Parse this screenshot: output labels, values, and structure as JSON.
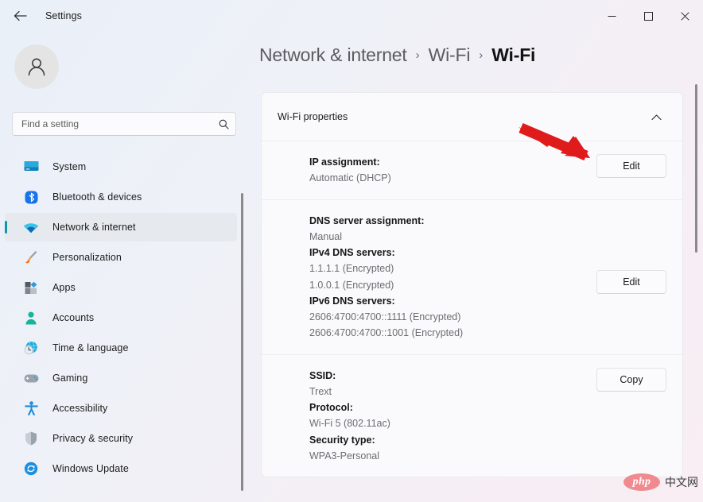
{
  "titlebar": {
    "back_icon": "back-arrow-icon",
    "app_title": "Settings",
    "minimize_label": "—",
    "maximize_label": "☐",
    "close_label": "✕"
  },
  "sidebar": {
    "avatar_icon": "user-avatar-icon",
    "search": {
      "placeholder": "Find a setting",
      "value": "",
      "icon": "search-icon"
    },
    "items": [
      {
        "label": "System",
        "icon": "monitor-icon",
        "active": false
      },
      {
        "label": "Bluetooth & devices",
        "icon": "bluetooth-icon",
        "active": false
      },
      {
        "label": "Network & internet",
        "icon": "wifi-icon",
        "active": true
      },
      {
        "label": "Personalization",
        "icon": "paintbrush-icon",
        "active": false
      },
      {
        "label": "Apps",
        "icon": "apps-icon",
        "active": false
      },
      {
        "label": "Accounts",
        "icon": "person-icon",
        "active": false
      },
      {
        "label": "Time & language",
        "icon": "clock-globe-icon",
        "active": false
      },
      {
        "label": "Gaming",
        "icon": "gamepad-icon",
        "active": false
      },
      {
        "label": "Accessibility",
        "icon": "accessibility-icon",
        "active": false
      },
      {
        "label": "Privacy & security",
        "icon": "shield-icon",
        "active": false
      },
      {
        "label": "Windows Update",
        "icon": "update-refresh-icon",
        "active": false
      }
    ]
  },
  "main": {
    "breadcrumb": {
      "items": [
        "Network & internet",
        "Wi-Fi",
        "Wi-Fi"
      ],
      "separator": "›"
    },
    "card": {
      "header_title": "Wi-Fi properties",
      "collapse_icon": "chevron-up-icon",
      "rows": [
        {
          "label": "IP assignment:",
          "value": "Automatic (DHCP)",
          "button": "Edit"
        },
        {
          "label": "DNS server assignment:",
          "value": "Manual",
          "label2": "IPv4 DNS servers:",
          "value2": "1.1.1.1 (Encrypted)\n1.0.0.1 (Encrypted)",
          "label3": "IPv6 DNS servers:",
          "value3": "2606:4700:4700::1111 (Encrypted)\n2606:4700:4700::1001 (Encrypted)",
          "button": "Edit"
        },
        {
          "label": "SSID:",
          "value": "Trext",
          "label2": "Protocol:",
          "value2": "Wi-Fi 5 (802.11ac)",
          "label3": "Security type:",
          "value3": "WPA3-Personal",
          "button": "Copy"
        }
      ]
    }
  },
  "annotation": {
    "arrow_color": "#e01b1b",
    "arrow_target": "edit-button-ip-assignment"
  },
  "watermark": {
    "logo_text": "php",
    "text": "中文网",
    "logo_color": "#f08a8e"
  },
  "colors": {
    "accent": "#0d9aa8",
    "active_nav_bg": "#e6eaee",
    "card_bg": "#fafafc",
    "window_bg": "#eff3f9"
  }
}
